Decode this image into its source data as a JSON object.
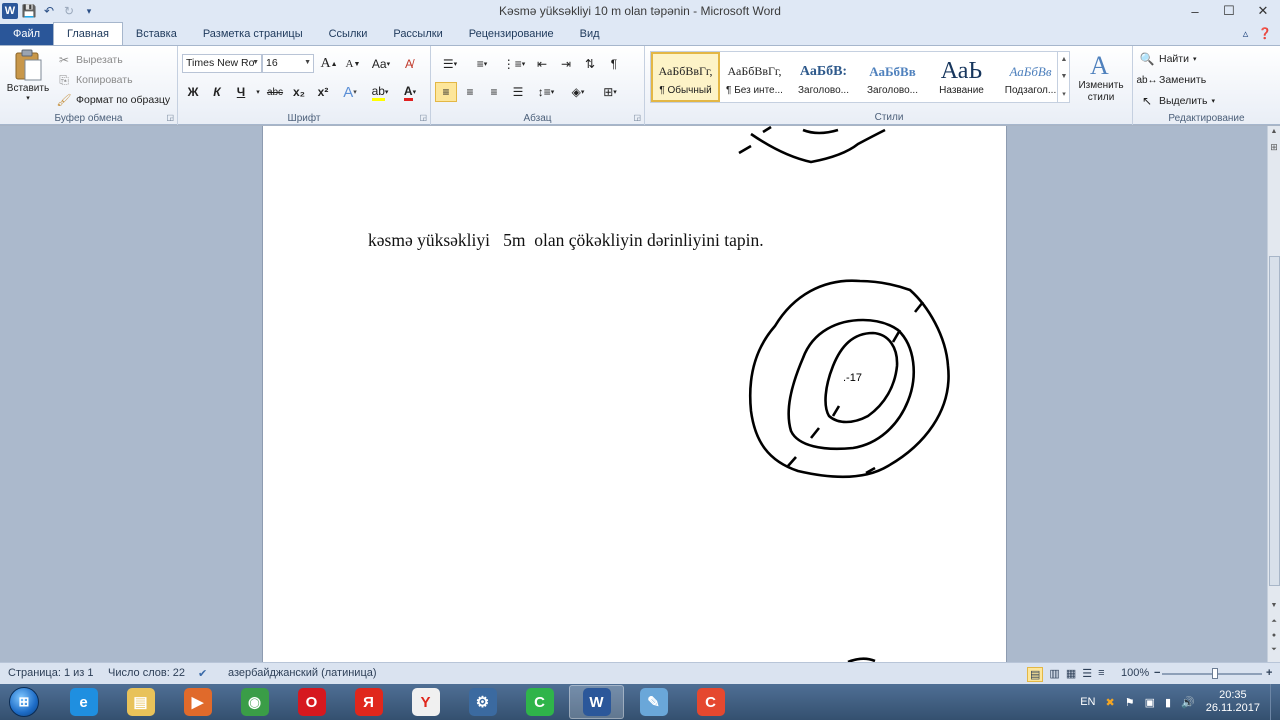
{
  "window": {
    "title": "Kəsmə yüksəkliyi  10 m   olan  təpənin  - Microsoft Word",
    "word_logo": "W",
    "controls": {
      "minimize": "‒",
      "maximize": "☐",
      "close": "✕"
    }
  },
  "qat": {
    "save_icon": "save-icon",
    "undo_icon": "undo-icon",
    "redo_icon": "redo-icon",
    "customize_icon": "customize-qat-icon"
  },
  "tabs": [
    {
      "label": "Файл"
    },
    {
      "label": "Главная"
    },
    {
      "label": "Вставка"
    },
    {
      "label": "Разметка страницы"
    },
    {
      "label": "Ссылки"
    },
    {
      "label": "Рассылки"
    },
    {
      "label": "Рецензирование"
    },
    {
      "label": "Вид"
    }
  ],
  "ribbon": {
    "clipboard": {
      "label": "Буфер обмена",
      "paste": "Вставить",
      "cut": "Вырезать",
      "copy": "Копировать",
      "format_painter": "Формат по образцу"
    },
    "font": {
      "label": "Шрифт",
      "family": "Times New Ro",
      "size": "16",
      "case_label": "Aa",
      "bold": "Ж",
      "italic": "К",
      "underline": "Ч",
      "strike": "abc",
      "subscript": "x₂",
      "superscript": "x²"
    },
    "paragraph": {
      "label": "Абзац",
      "pilcrow": "¶"
    },
    "styles": {
      "label": "Стили",
      "items": [
        {
          "sample": "АаБбВвГг,",
          "name": "¶ Обычный"
        },
        {
          "sample": "АаБбВвГг,",
          "name": "¶ Без инте..."
        },
        {
          "sample": "АаБбВ:",
          "name": "Заголово..."
        },
        {
          "sample": "АаБбВв",
          "name": "Заголово..."
        },
        {
          "sample": "АаЬ",
          "name": "Название"
        },
        {
          "sample": "АаБбВв",
          "name": "Подзагол..."
        }
      ],
      "change_styles": "Изменить стили"
    },
    "editing": {
      "label": "Редактирование",
      "find": "Найти",
      "replace": "Заменить",
      "select": "Выделить"
    }
  },
  "document": {
    "text_line": "kəsmə yüksəkliyi   5m  olan çökəkliyin dərinliyini tapin.",
    "point_label": ".-17"
  },
  "statusbar": {
    "page": "Страница: 1 из 1",
    "words": "Число слов: 22",
    "language": "азербайджанский (латиница)",
    "zoom": "100%",
    "zoom_level": 1.0,
    "minus": "−",
    "plus": "+"
  },
  "taskbar": {
    "apps": [
      {
        "name": "internet-explorer",
        "glyph": "e",
        "color": "#1f8fe0"
      },
      {
        "name": "file-explorer",
        "glyph": "▤",
        "color": "#e8c25a"
      },
      {
        "name": "media-player",
        "glyph": "▶",
        "color": "#e06a2b"
      },
      {
        "name": "chrome",
        "glyph": "◉",
        "color": "#3a9d47"
      },
      {
        "name": "opera",
        "glyph": "O",
        "color": "#d6181f"
      },
      {
        "name": "yandex",
        "glyph": "Я",
        "color": "#e0271c"
      },
      {
        "name": "yandex-browser",
        "glyph": "Y",
        "color": "#f0f0f0"
      },
      {
        "name": "settings",
        "glyph": "⚙",
        "color": "#3b6aa0"
      },
      {
        "name": "camtasia",
        "glyph": "C",
        "color": "#2fb44a"
      },
      {
        "name": "word",
        "glyph": "W",
        "color": "#2b579a"
      },
      {
        "name": "paint",
        "glyph": "✎",
        "color": "#6aa7d9"
      },
      {
        "name": "camtasia-recorder",
        "glyph": "C",
        "color": "#e5482f"
      }
    ],
    "lang": "EN",
    "time": "20:35",
    "date": "26.11.2017"
  }
}
